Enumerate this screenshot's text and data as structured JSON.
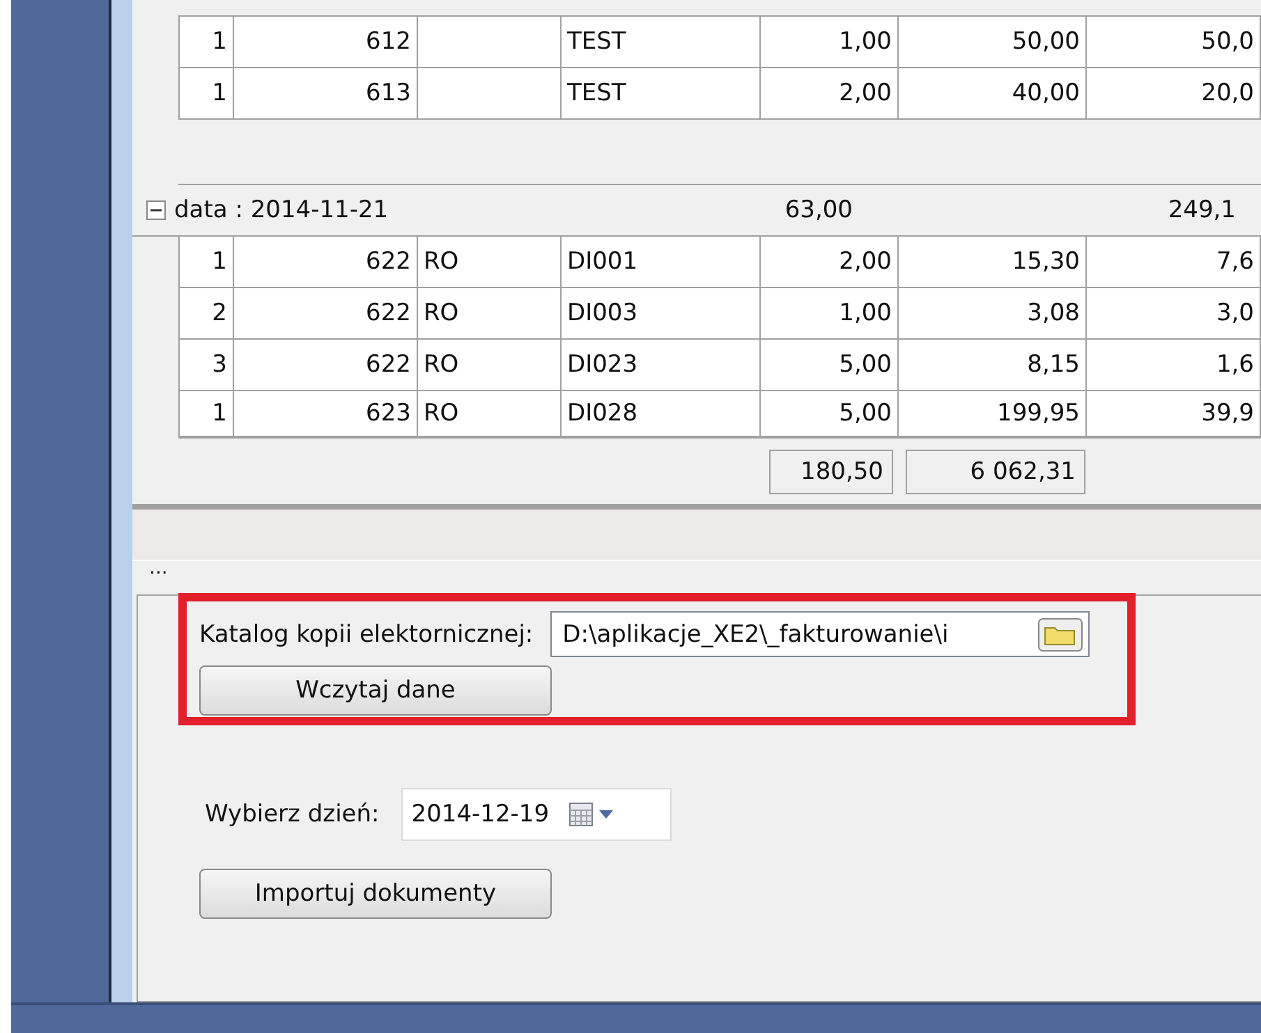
{
  "grid": {
    "rows_before": [
      {
        "cells": [
          "1",
          "612",
          "",
          "TEST",
          "1,00",
          "50,00",
          "50,0"
        ]
      },
      {
        "cells": [
          "1",
          "613",
          "",
          "TEST",
          "2,00",
          "40,00",
          "20,0"
        ]
      }
    ],
    "group": {
      "label": "data : 2014-11-21",
      "expanded": true,
      "total_quantity": "63,00",
      "total_value": "249,1"
    },
    "rows": [
      {
        "cells": [
          "1",
          "622",
          "RO",
          "DI001",
          "2,00",
          "15,30",
          "7,6"
        ]
      },
      {
        "cells": [
          "2",
          "622",
          "RO",
          "DI003",
          "1,00",
          "3,08",
          "3,0"
        ]
      },
      {
        "cells": [
          "3",
          "622",
          "RO",
          "DI023",
          "5,00",
          "8,15",
          "1,6"
        ]
      },
      {
        "cells": [
          "1",
          "623",
          "RO",
          "DI028",
          "5,00",
          "199,95",
          "39,9"
        ]
      }
    ],
    "footer_totals": [
      "180,50",
      "6 062,31"
    ]
  },
  "panel": {
    "caption": "...",
    "catalog": {
      "label": "Katalog kopii elektornicznej:",
      "value": "D:\\aplikacje_XE2\\_fakturowanie\\i"
    },
    "load_button": "Wczytaj dane",
    "day": {
      "label": "Wybierz dzień:",
      "value": "2014-12-19"
    },
    "import_button": "Importuj dokumenty"
  }
}
